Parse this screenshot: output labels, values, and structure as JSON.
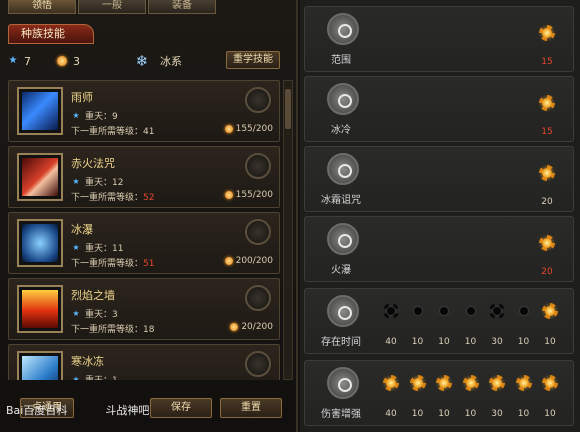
{
  "tabs": [
    "领悟",
    "一般",
    "装备"
  ],
  "race_tab": "种族技能",
  "stats": {
    "star_points": "7",
    "sun_points": "3",
    "element": "冰系"
  },
  "relearn_label": "重学技能",
  "skills": [
    {
      "name": "雨师",
      "level_label": "重天：9",
      "req_label": "下一重所需等级：",
      "req": "41",
      "req_red": false,
      "points": "155/200",
      "icon": "rain-icon"
    },
    {
      "name": "赤火法咒",
      "level_label": "重天：12",
      "req_label": "下一重所需等级：",
      "req": "52",
      "req_red": true,
      "points": "155/200",
      "icon": "fire-curse-icon"
    },
    {
      "name": "冰瀑",
      "level_label": "重天：11",
      "req_label": "下一重所需等级：",
      "req": "51",
      "req_red": true,
      "points": "200/200",
      "icon": "ice-fall-icon"
    },
    {
      "name": "烈焰之墙",
      "level_label": "重天：3",
      "req_label": "下一重所需等级：",
      "req": "18",
      "req_red": false,
      "points": "20/200",
      "icon": "flame-wall-icon"
    },
    {
      "name": "寒冰冻",
      "level_label": "重天：1",
      "req_label": "",
      "req": "",
      "req_red": false,
      "points": "",
      "icon": "frost-icon"
    }
  ],
  "bottom": {
    "save": "保存",
    "reset": "重置",
    "cut_label": "点通用"
  },
  "watermark": {
    "site": "Bai百度百科",
    "game": "斗战神吧"
  },
  "talents": [
    {
      "label": "范围",
      "nodes": [
        {
          "on": true,
          "value": "15",
          "red": true
        }
      ]
    },
    {
      "label": "冰冷",
      "nodes": [
        {
          "on": true,
          "value": "15",
          "red": true
        }
      ]
    },
    {
      "label": "冰霜诅咒",
      "nodes": [
        {
          "on": true,
          "value": "20",
          "red": false
        }
      ]
    },
    {
      "label": "火瀑",
      "nodes": [
        {
          "on": true,
          "value": "20",
          "red": true
        }
      ]
    },
    {
      "label": "存在时间",
      "nodes": [
        {
          "on": false,
          "big": true,
          "value": "40",
          "red": false
        },
        {
          "on": false,
          "big": false,
          "value": "10",
          "red": false
        },
        {
          "on": false,
          "big": false,
          "value": "10",
          "red": false
        },
        {
          "on": false,
          "big": false,
          "value": "10",
          "red": false
        },
        {
          "on": false,
          "big": true,
          "value": "30",
          "red": false
        },
        {
          "on": false,
          "big": false,
          "value": "10",
          "red": false
        },
        {
          "on": true,
          "value": "10",
          "red": false
        }
      ]
    },
    {
      "label": "伤害增强",
      "nodes": [
        {
          "on": true,
          "value": "40",
          "red": false
        },
        {
          "on": true,
          "value": "10",
          "red": false
        },
        {
          "on": true,
          "value": "10",
          "red": false
        },
        {
          "on": true,
          "value": "10",
          "red": false
        },
        {
          "on": true,
          "value": "30",
          "red": false
        },
        {
          "on": true,
          "value": "10",
          "red": false
        },
        {
          "on": true,
          "value": "10",
          "red": false
        }
      ]
    }
  ],
  "colors": {
    "accent_gold": "#f0d68c",
    "warning_red": "#e8462e",
    "star_blue": "#5ab8ff"
  }
}
